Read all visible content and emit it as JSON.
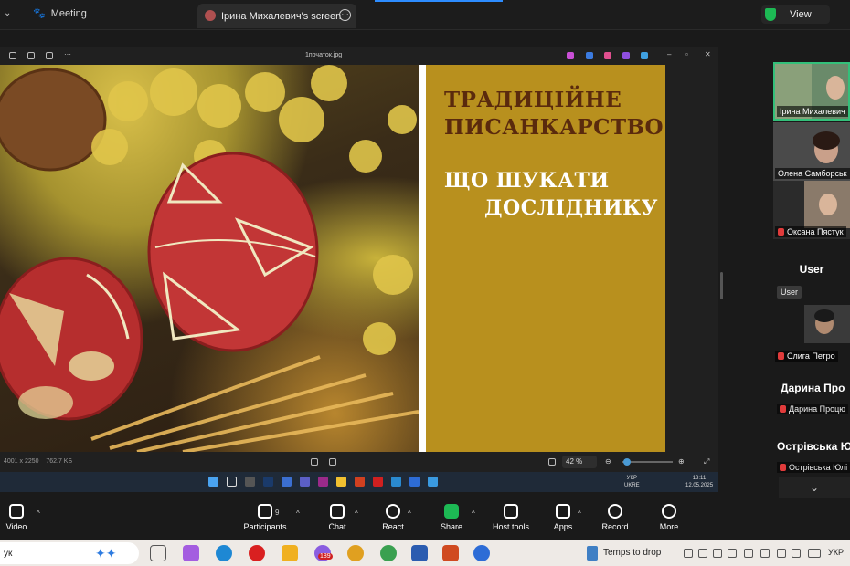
{
  "topbar": {
    "meeting_label": "Meeting",
    "screen_tab_label": "Ірина Михалевич's screen",
    "view_label": "View"
  },
  "viewer": {
    "file_name": "1початок.jpg",
    "dimensions": "4001 x 2250",
    "file_size": "762.7 KБ",
    "zoom_value": "42 %",
    "zoom_level": 0.05
  },
  "slide": {
    "title_line1": "ТРАДИЦІЙНЕ",
    "title_line2": "ПИСАНКАРСТВО:",
    "subtitle_line1": "ЩО ШУКАТИ",
    "subtitle_line2": "ДОСЛІДНИКУ"
  },
  "remote_taskbar": {
    "lang_top": "УКР",
    "lang_bottom": "UKRE",
    "time": "13:11",
    "date": "12.05.2025"
  },
  "participants": [
    {
      "name": "Ірина Михалевич",
      "muted": false,
      "active": true
    },
    {
      "name": "Олена Самборськ",
      "muted": false,
      "active": false
    },
    {
      "name": "Оксана Пястук",
      "muted": true,
      "active": false
    }
  ],
  "user_section": {
    "heading": "User",
    "chip": "User",
    "participant": "Слига Петро"
  },
  "darina_section": {
    "heading": "Дарина Про",
    "participant": "Дарина Процю"
  },
  "ostrivska_section": {
    "heading": "Острівська Ю",
    "participant": "Острівська Юлі"
  },
  "toolbar": {
    "video": "Video",
    "participants": "Participants",
    "participants_count": "9",
    "chat": "Chat",
    "react": "React",
    "share": "Share",
    "host_tools": "Host tools",
    "apps": "Apps",
    "record": "Record",
    "more": "More"
  },
  "windows_taskbar": {
    "search_text": "ук",
    "badge": "189",
    "drop_text": "Temps to drop",
    "lang": "УКР"
  },
  "colors": {
    "slide_bg": "#b8901e",
    "title_color": "#5a2a0d",
    "active_border": "#33c07a",
    "share_green": "#1db954"
  }
}
